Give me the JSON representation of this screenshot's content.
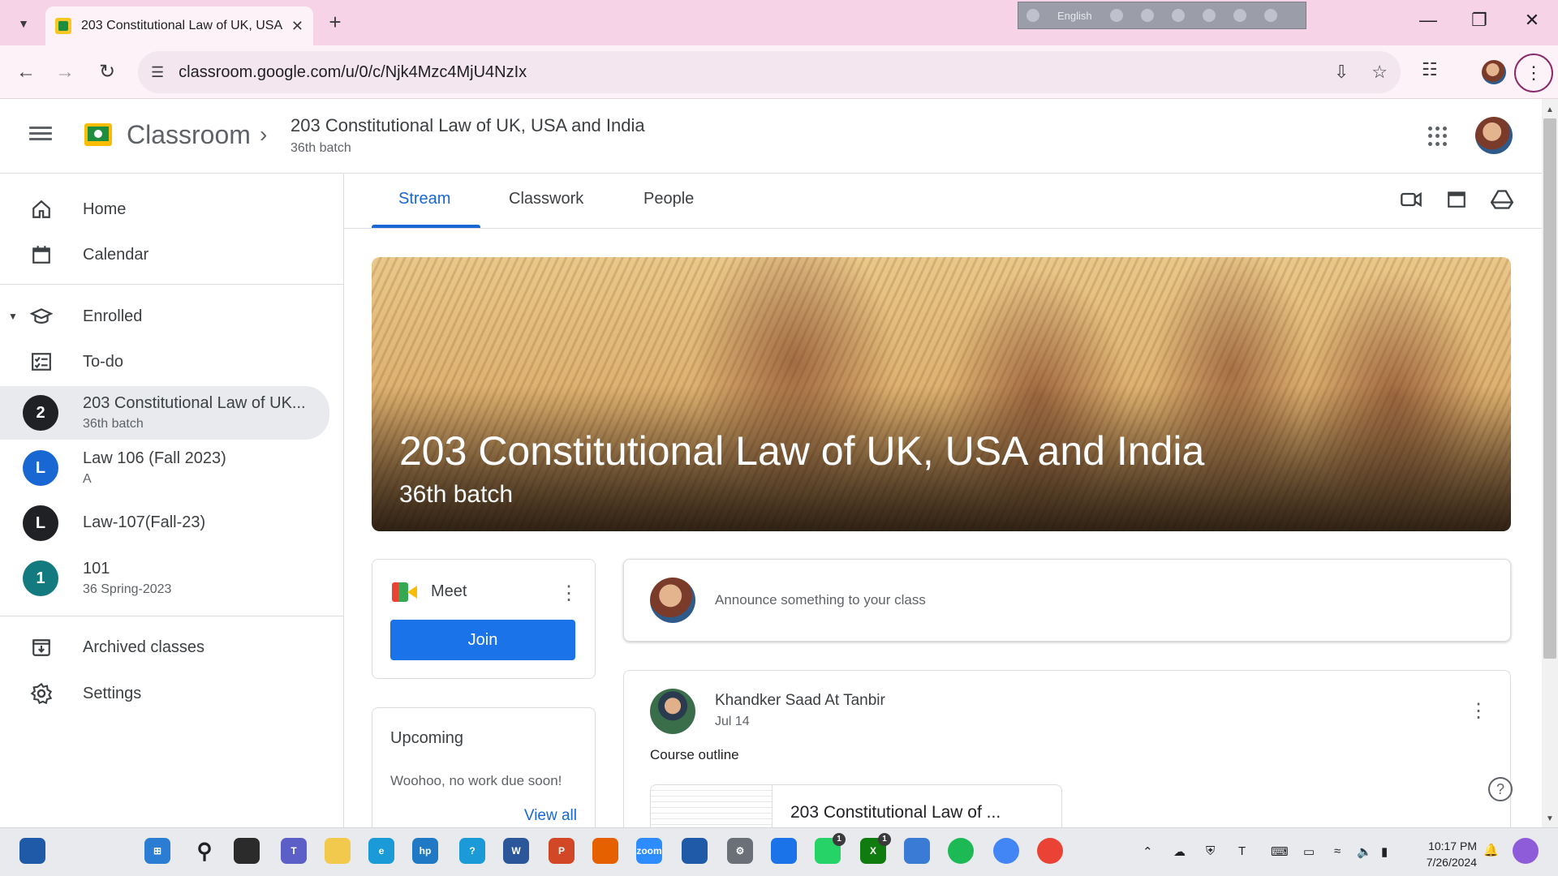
{
  "browser": {
    "tab_title": "203 Constitutional Law of UK, USA",
    "url": "classroom.google.com/u/0/c/Njk4Mzc4MjU4NzIx",
    "language_label": "English"
  },
  "header": {
    "app_name": "Classroom",
    "class_title": "203 Constitutional Law of UK, USA and India",
    "class_subtitle": "36th batch"
  },
  "sidebar": {
    "home": "Home",
    "calendar": "Calendar",
    "enrolled": "Enrolled",
    "todo": "To-do",
    "classes": [
      {
        "initial": "2",
        "name": "203 Constitutional Law of UK...",
        "section": "36th batch",
        "color": "#202124"
      },
      {
        "initial": "L",
        "name": "Law 106 (Fall 2023)",
        "section": "A",
        "color": "#1967d2"
      },
      {
        "initial": "L",
        "name": "Law-107(Fall-23)",
        "section": "",
        "color": "#202124"
      },
      {
        "initial": "1",
        "name": "101",
        "section": "36 Spring-2023",
        "color": "#137a7f"
      }
    ],
    "archived": "Archived classes",
    "settings": "Settings"
  },
  "tabs": {
    "stream": "Stream",
    "classwork": "Classwork",
    "people": "People"
  },
  "banner": {
    "title": "203 Constitutional Law of UK, USA and India",
    "subtitle": "36th batch"
  },
  "meet": {
    "title": "Meet",
    "join": "Join"
  },
  "upcoming": {
    "title": "Upcoming",
    "empty": "Woohoo, no work due soon!",
    "view_all": "View all"
  },
  "announce": {
    "placeholder": "Announce something to your class"
  },
  "post": {
    "author": "Khandker Saad At Tanbir",
    "date": "Jul 14",
    "body": "Course outline",
    "attachment": "203 Constitutional Law of ..."
  },
  "taskbar": {
    "time": "10:17 PM",
    "date": "7/26/2024",
    "whatsapp_badge": "1",
    "xbox_badge": "1"
  },
  "colors": {
    "accent": "#1967d2",
    "join_button": "#1a73e8",
    "chrome_tabbar": "#f6d3e6"
  }
}
